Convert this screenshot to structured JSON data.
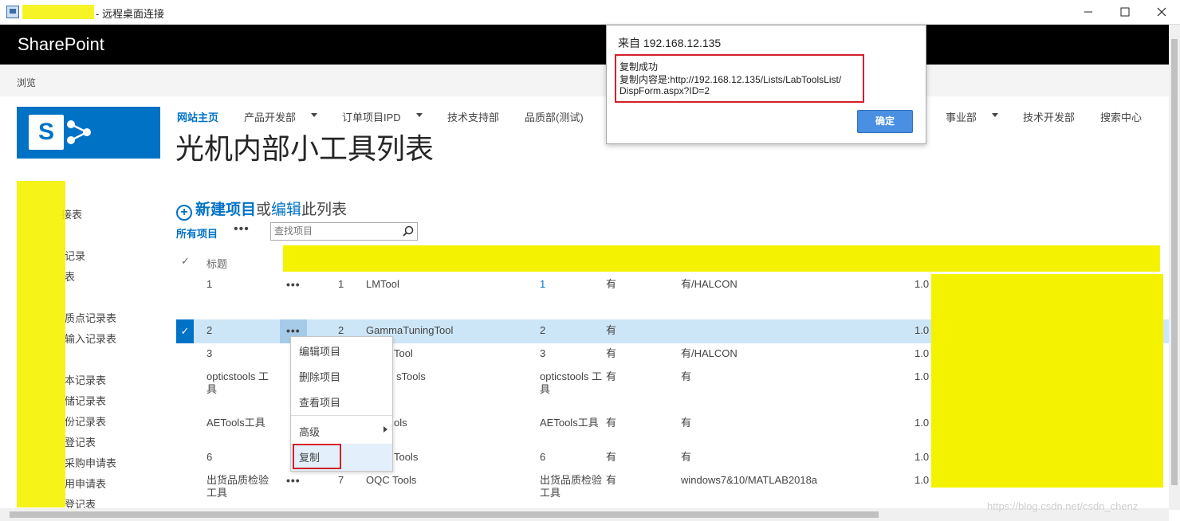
{
  "window": {
    "title": "- 远程桌面连接",
    "minimize_icon": "minimize-icon",
    "maximize_icon": "maximize-icon",
    "close_icon": "close-icon"
  },
  "suite": {
    "brand": "SharePoint"
  },
  "ribbon": {
    "browse": "浏览"
  },
  "topnav": {
    "items": [
      "网站主页",
      "产品开发部",
      "订单项目IPD",
      "技术支持部",
      "品质部(测试)",
      "事业部",
      "技术开发部",
      "搜索中心"
    ]
  },
  "page": {
    "title": "光机内部小工具列表"
  },
  "quicklaunch": {
    "items": [
      "",
      "接表",
      "",
      "记录",
      "表",
      "",
      "质点记录表",
      "输入记录表",
      "",
      "本记录表",
      "储记录表",
      "份记录表",
      "登记表",
      "采购申请表",
      "用申请表",
      "登记表"
    ]
  },
  "list": {
    "new_item": "新建项目",
    "or": "或",
    "edit": "编辑",
    "this_list": "此列表",
    "view_all": "所有项目",
    "search_placeholder": "查找项目",
    "header_title": "标题",
    "rows": [
      {
        "title": "1",
        "id": "1",
        "name": "LMTool",
        "num": "1",
        "has": "有",
        "env": "有/HALCON",
        "ver": "1.0"
      },
      {
        "title": "2",
        "id": "2",
        "name": "GammaTuningTool",
        "num": "2",
        "has": "有",
        "env": "",
        "ver": "1.0"
      },
      {
        "title": "3",
        "id": "",
        "name": "Tool",
        "num": "3",
        "has": "有",
        "env": "有/HALCON",
        "ver": "1.0"
      },
      {
        "title": "opticstools 工具",
        "id": "",
        "name": "sTools",
        "num": "opticstools 工具",
        "has": "有",
        "env": "有",
        "ver": "1.0"
      },
      {
        "title": "AETools工具",
        "id": "",
        "name": "ols",
        "num": "AETools工具",
        "has": "有",
        "env": "有",
        "ver": "1.0"
      },
      {
        "title": "6",
        "id": "",
        "name": "Tools",
        "num": "6",
        "has": "有",
        "env": "有",
        "ver": "1.0"
      },
      {
        "title": "出货品质检验工具",
        "id": "7",
        "name": "OQC Tools",
        "num": "出货品质检验工具",
        "has": "有",
        "env": "windows7&10/MATLAB2018a",
        "ver": "1.0"
      }
    ]
  },
  "context_menu": {
    "edit": "编辑项目",
    "delete": "删除项目",
    "view": "查看项目",
    "advanced": "高级",
    "copy": "复制"
  },
  "dialog": {
    "title": "来自 192.168.12.135",
    "line1": "复制成功",
    "line2": "复制内容是:http://192.168.12.135/Lists/LabToolsList/",
    "line3": "DispForm.aspx?ID=2",
    "ok": "确定"
  },
  "watermark": "https://blog.csdn.net/csdn_chenz",
  "colors": {
    "accent": "#0072c6",
    "suitebar": "#000000",
    "highlight": "#f5f200",
    "alert_outline": "#d3202a"
  }
}
